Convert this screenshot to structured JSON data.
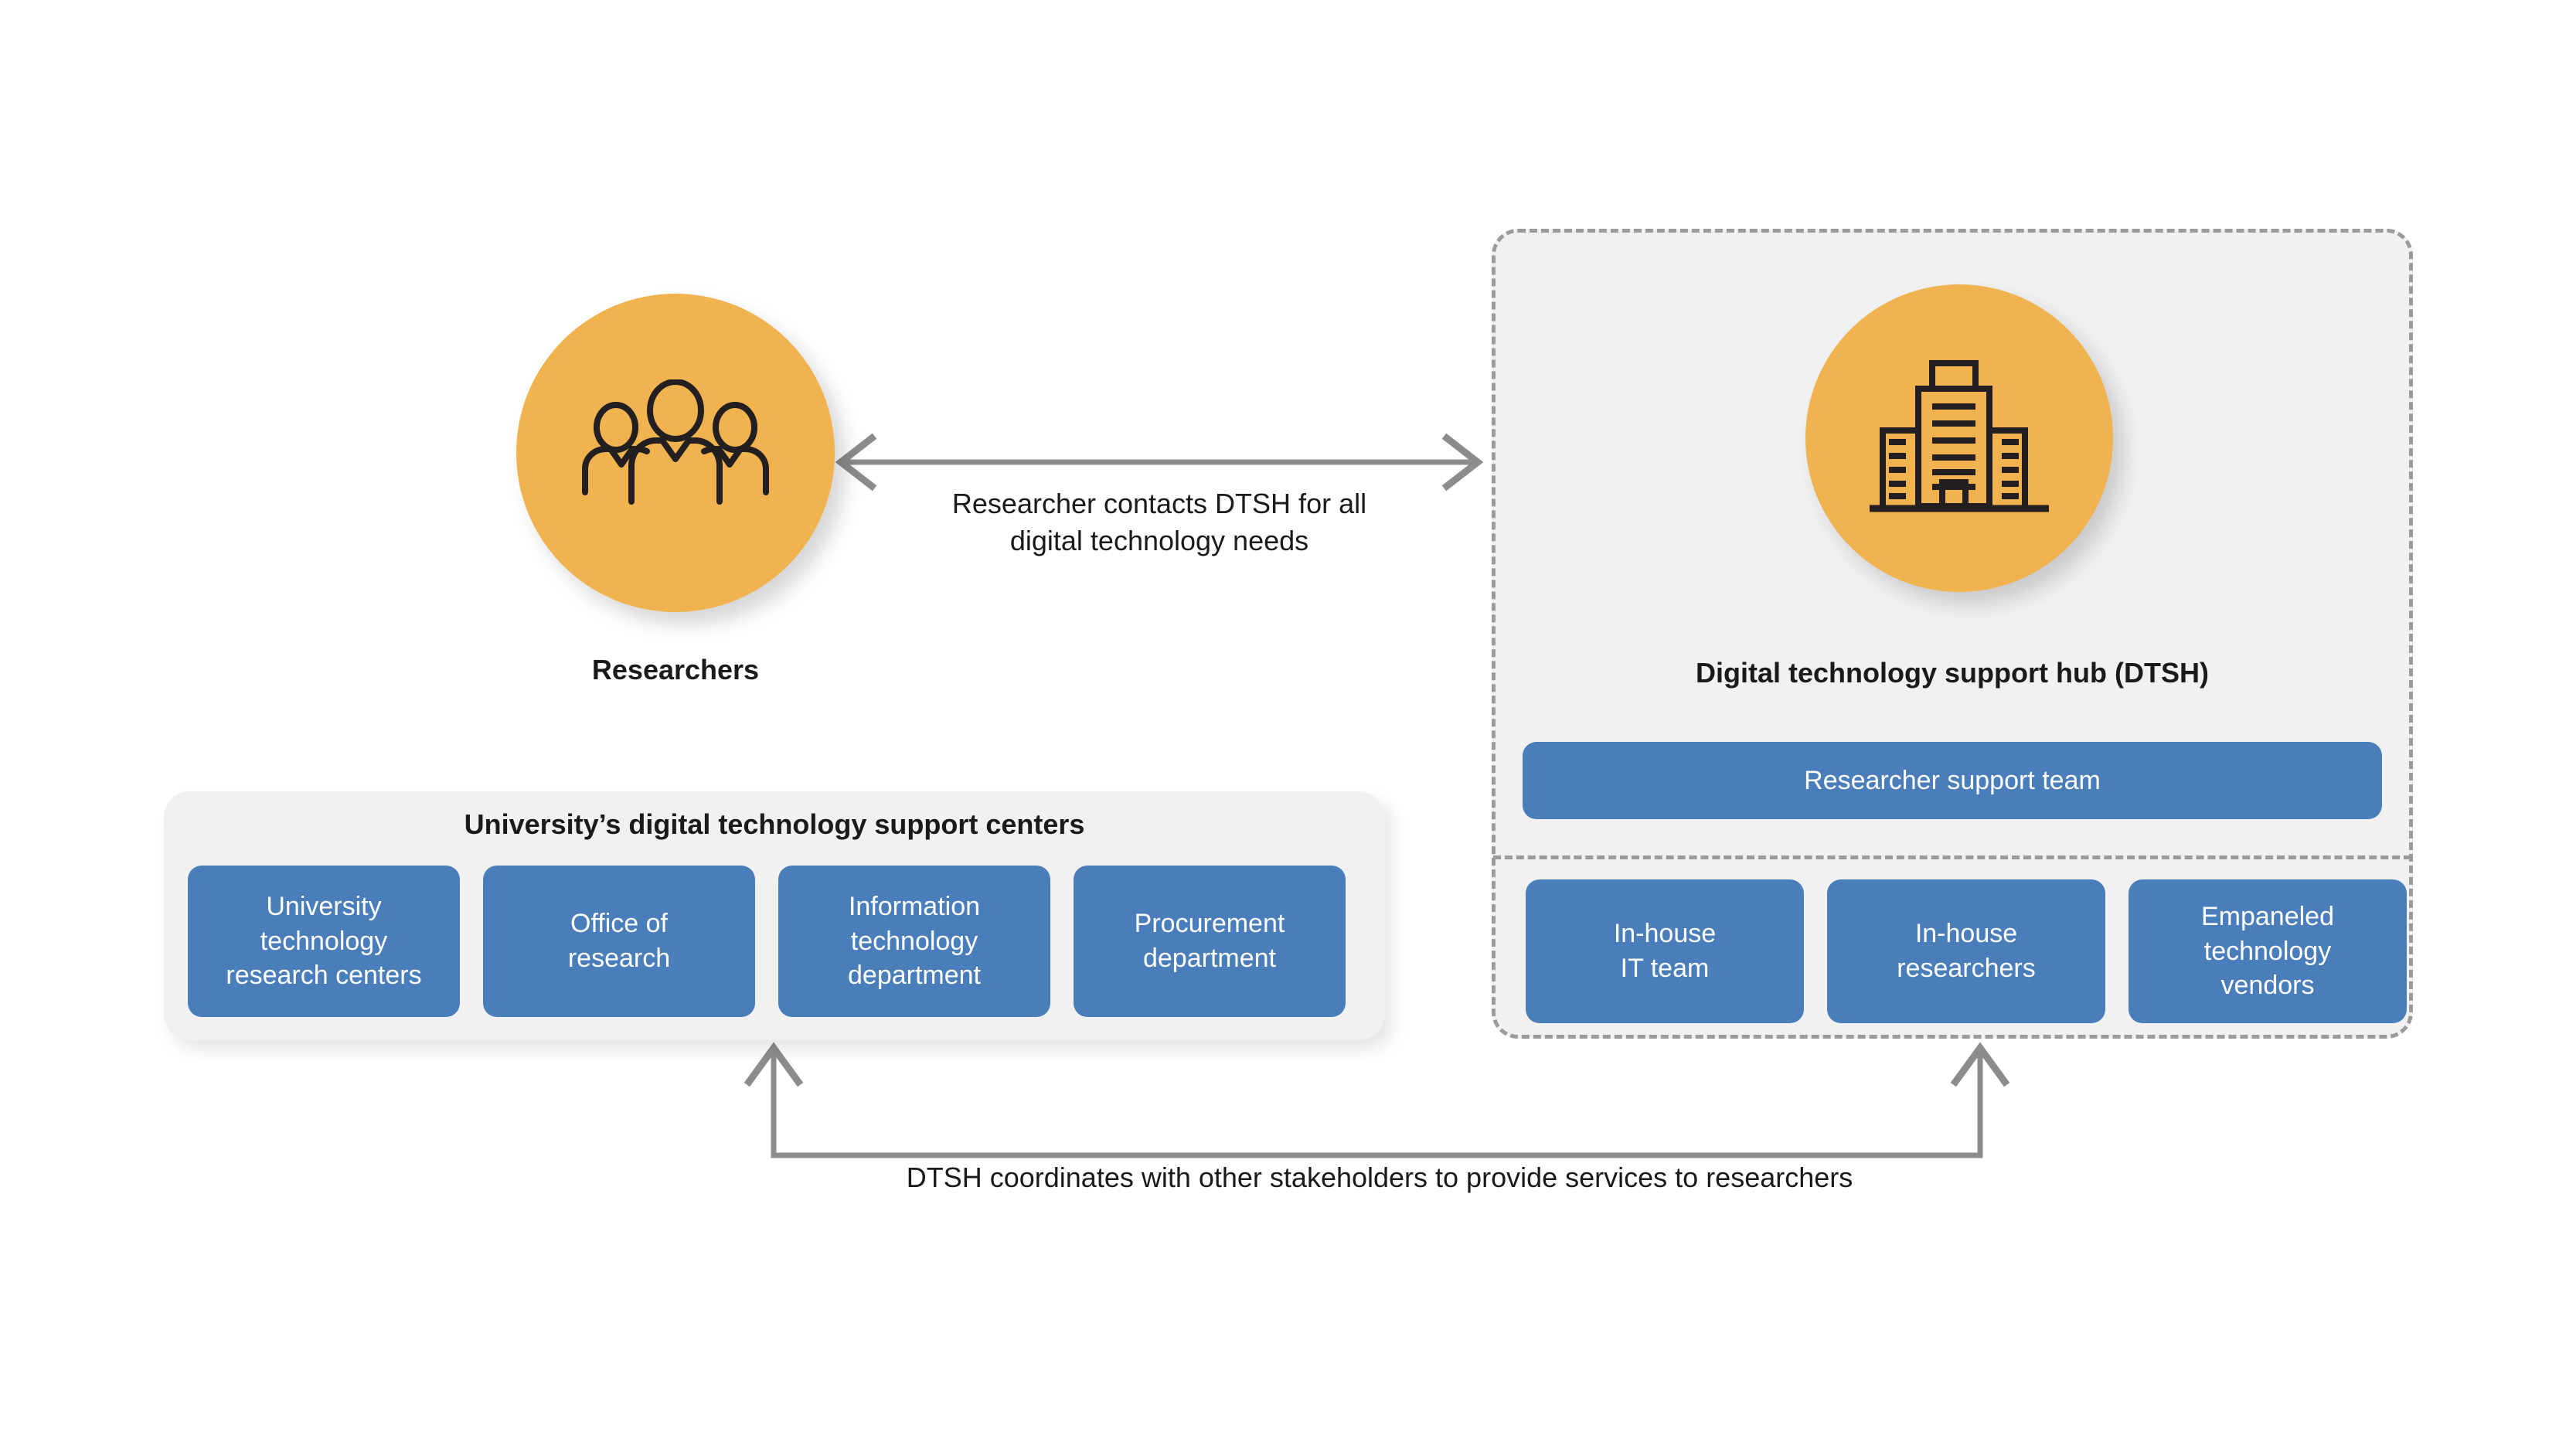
{
  "colors": {
    "orange": "#f0b350",
    "blue": "#4a7ebb",
    "panel_grey": "#f1f1f1",
    "dash_grey": "#9b9b9b",
    "arrow_grey": "#8c8c8c",
    "text_dark": "#1a1a1a",
    "text_on_blue": "#ffffff",
    "background": "#ffffff"
  },
  "researchers": {
    "label": "Researchers",
    "icon": "three-people-icon"
  },
  "hub": {
    "title": "Digital technology support hub (DTSH)",
    "icon": "office-building-icon",
    "support_team": {
      "label": "Researcher support team"
    },
    "resources": [
      {
        "label": "In-house\nIT team"
      },
      {
        "label": "In-house\nresearchers"
      },
      {
        "label": "Empaneled\ntechnology\nvendors"
      }
    ]
  },
  "support_centers": {
    "title": "University’s digital technology support centers",
    "items": [
      {
        "label": "University\ntechnology\nresearch centers"
      },
      {
        "label": "Office of\nresearch"
      },
      {
        "label": "Information\ntechnology\ndepartment"
      },
      {
        "label": "Procurement\ndepartment"
      }
    ]
  },
  "connectors": {
    "top": {
      "label": "Researcher contacts DTSH for all\ndigital technology needs",
      "style": "double-headed-horizontal-arrow"
    },
    "bottom": {
      "label": "DTSH coordinates with other stakeholders to provide services to researchers",
      "style": "double-headed-u-arrow"
    }
  }
}
